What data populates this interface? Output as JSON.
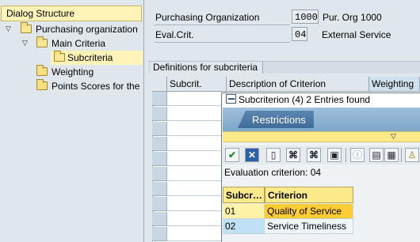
{
  "tree": {
    "header": "Dialog Structure",
    "items": [
      {
        "label": "Purchasing organization"
      },
      {
        "label": "Main Criteria"
      },
      {
        "label": "Subcriteria"
      },
      {
        "label": "Weighting"
      },
      {
        "label": "Points Scores for the"
      }
    ]
  },
  "fields": {
    "purch_org_label": "Purchasing Organization",
    "purch_org_value": "1000",
    "purch_org_desc": "Pur. Org 1000",
    "eval_crit_label": "Eval.Crit.",
    "eval_crit_value": "04",
    "eval_crit_desc": "External Service"
  },
  "definitions": {
    "title": "Definitions for subcriteria",
    "columns": [
      "Subcrit.",
      "Description of Criterion",
      "Weighting"
    ]
  },
  "popup": {
    "title": "Subcriterion (4)   2 Entries found",
    "restrictions_tab": "Restrictions",
    "evaluation_text": "Evaluation criterion: 04",
    "columns": [
      "Subcr…",
      "Criterion"
    ],
    "rows": [
      {
        "code": "01",
        "criterion": "Quality of Service"
      },
      {
        "code": "02",
        "criterion": "Service Timeliness"
      }
    ],
    "toolbar_icons": [
      "check-icon",
      "cancel-icon",
      "new-icon",
      "find-icon",
      "find-next-icon",
      "filter-icon",
      "info-icon",
      "print-icon",
      "settings-icon",
      "user-icon"
    ]
  },
  "colors": {
    "selection_yellow": "#fff3b8",
    "highlight_orange": "#ffcc33",
    "restrictions_blue": "#4a78a5"
  }
}
